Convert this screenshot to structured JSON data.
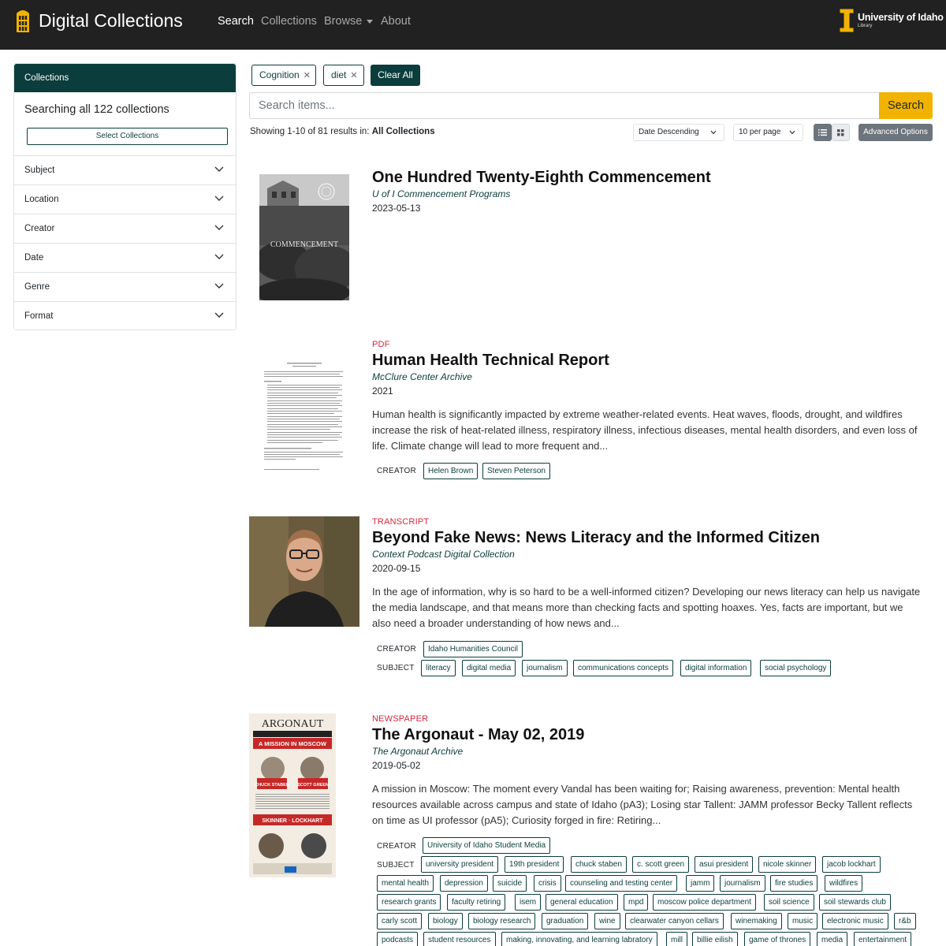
{
  "navbar": {
    "brand": "Digital Collections",
    "links": [
      "Search",
      "Collections",
      "Browse",
      "About"
    ],
    "university_name": "University of Idaho",
    "university_sub": "Library"
  },
  "sidebar": {
    "header": "Collections",
    "searching_text": "Searching all 122 collections",
    "select_button": "Select Collections",
    "facets": [
      "Subject",
      "Location",
      "Creator",
      "Date",
      "Genre",
      "Format"
    ]
  },
  "filters": {
    "chips": [
      "Cognition",
      "diet"
    ],
    "clear_all": "Clear All"
  },
  "search": {
    "placeholder": "Search items...",
    "button": "Search"
  },
  "results_bar": {
    "showing_prefix": "Showing 1-10 of 81 results in:",
    "showing_scope": "All Collections",
    "sort_value": "Date Descending",
    "per_page_value": "10 per page",
    "advanced_options": "Advanced Options"
  },
  "results": [
    {
      "type": "",
      "title": "One Hundred Twenty-Eighth Commencement",
      "collection": "U of I Commencement Programs",
      "date": "2023-05-13",
      "description": "",
      "thumb_text": "COMMENCEMENT"
    },
    {
      "type": "PDF",
      "title": "Human Health Technical Report",
      "collection": "McClure Center Archive",
      "date": "2021",
      "description": "Human health is significantly impacted by extreme weather-related events. Heat waves, floods, drought, and wildfires increase the risk of heat-related illness, respiratory illness, infectious diseases, mental health disorders, and even loss of life. Climate change will lead to more frequent and...",
      "creator_label": "CREATOR",
      "creators": [
        "Helen Brown",
        "Steven Peterson"
      ]
    },
    {
      "type": "TRANSCRIPT",
      "title": "Beyond Fake News: News Literacy and the Informed Citizen",
      "collection": "Context Podcast Digital Collection",
      "date": "2020-09-15",
      "description": "In the age of information, why is so hard to be a well-informed citizen? Developing our news literacy can help us navigate the media landscape, and that means more than checking facts and spotting hoaxes. Yes, facts are important, but we also need a broader understanding of how news and...",
      "creator_label": "CREATOR",
      "creators": [
        "Idaho Humanities Council"
      ],
      "subject_label": "SUBJECT",
      "subjects": [
        "literacy",
        "digital media",
        "journalism",
        "communications concepts",
        "digital information",
        "social psychology"
      ]
    },
    {
      "type": "NEWSPAPER",
      "title": "The Argonaut - May 02, 2019",
      "collection": "The Argonaut Archive",
      "date": "2019-05-02",
      "description": "A mission in Moscow: The moment every Vandal has been waiting for; Raising awareness, prevention: Mental health resources available across campus and state of Idaho (pA3); Losing star Tallent: JAMM professor Becky Tallent reflects on time as UI professor (pA5); Curiosity forged in fire: Retiring...",
      "creator_label": "CREATOR",
      "creators": [
        "University of Idaho Student Media"
      ],
      "subject_label": "SUBJECT",
      "subjects": [
        "university president",
        "19th president",
        "chuck staben",
        "c. scott green",
        "asui president",
        "nicole skinner",
        "jacob lockhart",
        "mental health",
        "depression",
        "suicide",
        "crisis",
        "counseling and testing center",
        "jamm",
        "journalism",
        "fire studies",
        "wildfires",
        "research grants",
        "faculty retiring",
        "isem",
        "general education",
        "mpd",
        "moscow police department",
        "soil science",
        "soil stewards club",
        "carly scott",
        "biology",
        "biology research",
        "graduation",
        "wine",
        "clearwater canyon cellars",
        "winemaking",
        "music",
        "electronic music",
        "r&b",
        "podcasts",
        "student resources",
        "making, innovating, and learning labratory",
        "mill",
        "billie eilish",
        "game of thrones",
        "media",
        "entertainment"
      ],
      "thumb_masthead": "ARGONAUT",
      "thumb_headline": "A MISSION IN MOSCOW",
      "thumb_names": [
        "CHUCK STABEN",
        "SCOTT GREEN",
        "SKINNER",
        "LOCKHART"
      ]
    }
  ],
  "colors": {
    "navbar": "#212121",
    "primary": "#0b3d3c",
    "accent": "#f1b300",
    "type_label": "#d7263d"
  }
}
